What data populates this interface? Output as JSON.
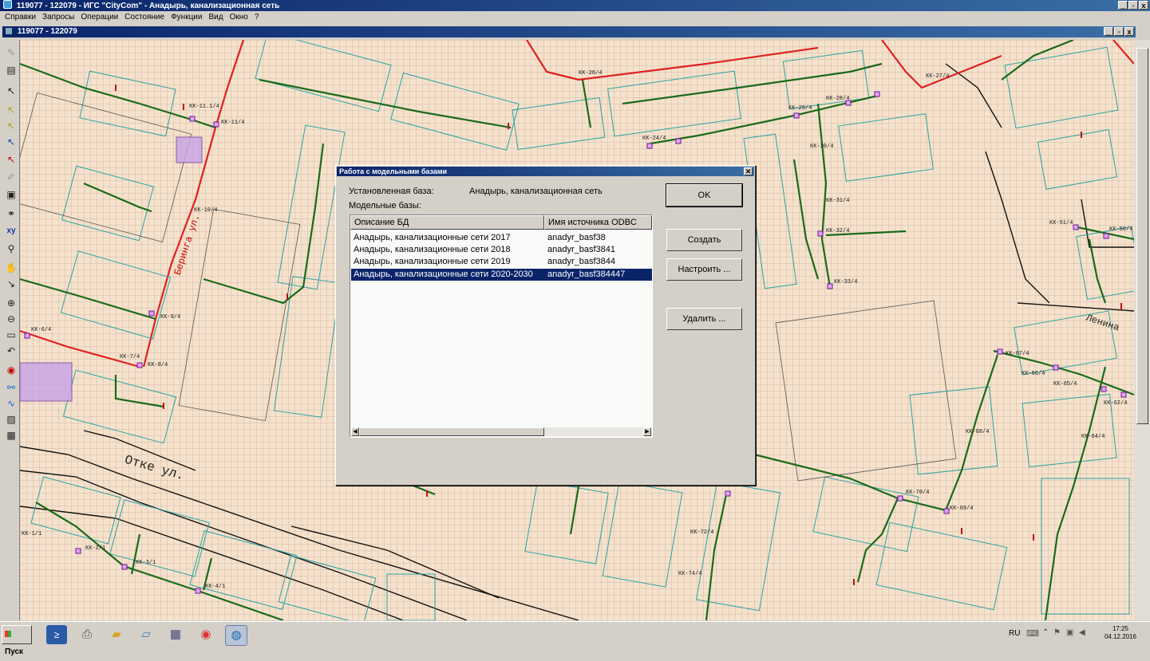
{
  "window": {
    "title": "119077 - 122079 - ИГС \"CityCom\" - Анадырь, канализационная сеть",
    "controls": [
      "_",
      "▫",
      "x"
    ]
  },
  "menu": [
    "Справки",
    "Запросы",
    "Операции",
    "Состояние",
    "Функции",
    "Вид",
    "Окно",
    "?"
  ],
  "document": {
    "title": "119077 - 122079"
  },
  "map": {
    "streets": [
      "Отке ул.",
      "Ленина",
      "Беринга ул."
    ],
    "wells": [
      "КК-11.1/4",
      "КК-11/4",
      "КК-10/4",
      "КК-9/4",
      "КК-8/4",
      "КК-7/4",
      "КК-6/4",
      "КК-26/4",
      "КК-27/4",
      "КК-28/4",
      "КК-29/4",
      "КК-30/4",
      "КК-31/4",
      "КК-32/4",
      "КК-33/4",
      "КК-24/4",
      "КК-50/4",
      "КК-51/4",
      "КК-64/4",
      "КК-65/4",
      "КК-66/4",
      "КК-67/4",
      "КК-62/4",
      "КК-68/4",
      "КК-69/4",
      "КК-70/4",
      "КК-72/4",
      "КК-74/4",
      "КК-3/1",
      "КК-4/1",
      "КК-2/1",
      "КК-1/1"
    ]
  },
  "dialog": {
    "title": "Работа с модельными базами",
    "installed_label": "Установленная база:",
    "installed_value": "Анадырь, канализационная сеть",
    "models_label": "Модельные базы:",
    "columns": [
      "Описание БД",
      "Имя источника ODBC"
    ],
    "rows": [
      {
        "description": "Анадырь, канализационные сети 2017",
        "odbc": "anadyr_basf38",
        "selected": false
      },
      {
        "description": "Анадырь, канализационные сети 2018",
        "odbc": "anadyr_basf3841",
        "selected": false
      },
      {
        "description": "Анадырь, канализационные сети 2019",
        "odbc": "anadyr_basf3844",
        "selected": false
      },
      {
        "description": "Анадырь, канализационные сети 2020-2030",
        "odbc": "anadyr_basf384447",
        "selected": true
      }
    ],
    "buttons": {
      "ok": "OK",
      "create": "Создать",
      "configure": "Настроить ...",
      "delete": "Удалить ..."
    }
  },
  "taskbar": {
    "start": "Пуск",
    "lang": "RU",
    "time": "17:25",
    "date": "04.12.2016",
    "apps": [
      "powershell-icon",
      "printer-icon",
      "folder-icon",
      "notepad-icon",
      "calculator-icon",
      "chrome-icon",
      "globe-icon"
    ]
  },
  "colors": {
    "map_bg": "#f6e2cc",
    "sewer_line": "#1a6a1a",
    "red_line": "#e02020",
    "building": "#2aa3a3",
    "titlebar": "#0a246a",
    "selection": "#0a246a"
  }
}
